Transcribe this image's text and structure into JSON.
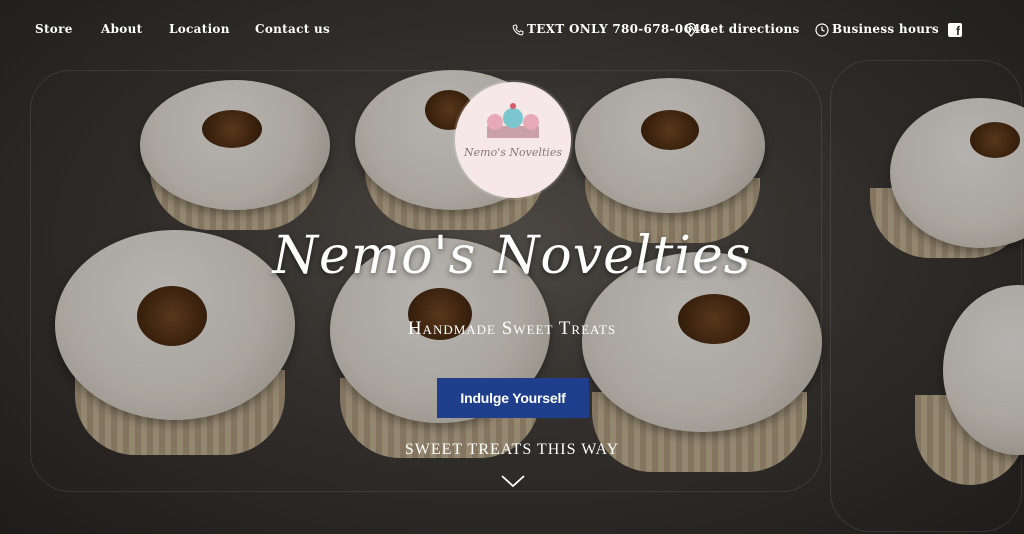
{
  "nav": {
    "left_items": [
      {
        "label": "Store"
      },
      {
        "label": "About"
      },
      {
        "label": "Location"
      },
      {
        "label": "Contact us"
      }
    ],
    "right_items": [
      {
        "icon": "phone-icon",
        "label": "TEXT ONLY 780-678-0649"
      },
      {
        "icon": "map-pin-icon",
        "label": "Get directions"
      },
      {
        "icon": "clock-icon",
        "label": "Business hours"
      }
    ],
    "social_icon": "facebook-icon",
    "social_glyph": "f"
  },
  "logo": {
    "text": "Nemo's Novelties"
  },
  "hero": {
    "title": "Nemo's Novelties",
    "tagline": "Handmade Sweet Treats",
    "cta_label": "Indulge Yourself",
    "scroll_text": "SWEET TREATS THIS WAY"
  },
  "colors": {
    "accent": "#1f3f8c",
    "text": "#ffffff"
  }
}
